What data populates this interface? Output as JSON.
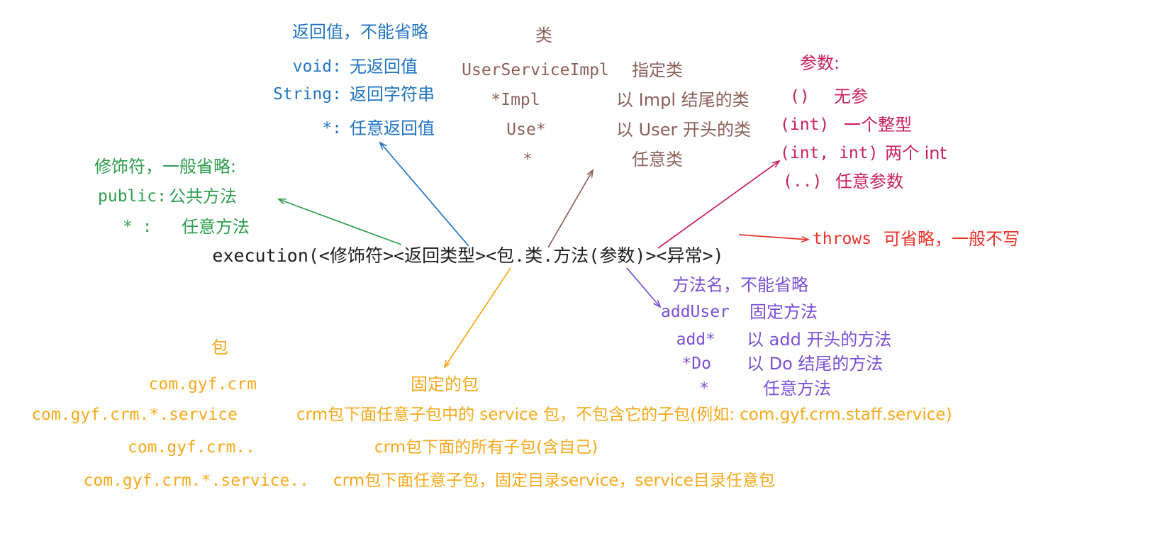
{
  "colors": {
    "modifier_green": "#2f9e4f",
    "return_blue": "#2275c2",
    "class_brown": "#8c6059",
    "params_crimson": "#c8215c",
    "method_purple": "#7a4fd6",
    "throws_red": "#e8332a",
    "package_orange": "#f7a81b",
    "formula_black": "#1d1d1f",
    "background": "#ffffff"
  },
  "formula": {
    "text": "execution(<修饰符><返回类型><包.类.方法(参数)><异常>)"
  },
  "modifier": {
    "title": "修饰符，一般省略:",
    "rows": [
      {
        "pattern": "public:",
        "desc": "公共方法"
      },
      {
        "pattern": "* :",
        "desc": "任意方法"
      }
    ]
  },
  "return_type": {
    "title": "返回值，不能省略",
    "rows": [
      {
        "pattern": "void:",
        "desc": "无返回值"
      },
      {
        "pattern": "String:",
        "desc": "返回字符串"
      },
      {
        "pattern": "*:",
        "desc": "任意返回值"
      }
    ]
  },
  "class_part": {
    "title": "类",
    "rows": [
      {
        "pattern": "UserServiceImpl",
        "desc": "指定类"
      },
      {
        "pattern": "*Impl",
        "desc": "以 Impl 结尾的类"
      },
      {
        "pattern": "Use*",
        "desc": "以 User 开头的类"
      },
      {
        "pattern": "*",
        "desc": "任意类"
      }
    ]
  },
  "params": {
    "title": "参数:",
    "rows": [
      {
        "pattern": "()",
        "desc": "无参"
      },
      {
        "pattern": "(int)",
        "desc": "一个整型"
      },
      {
        "pattern": "(int, int)",
        "desc": "两个 int"
      },
      {
        "pattern": "(..)",
        "desc": "任意参数"
      }
    ]
  },
  "method": {
    "title": "方法名，不能省略",
    "rows": [
      {
        "pattern": "addUser",
        "desc": "固定方法"
      },
      {
        "pattern": "add*",
        "desc": "以 add 开头的方法"
      },
      {
        "pattern": "*Do",
        "desc": "以 Do 结尾的方法"
      },
      {
        "pattern": "*",
        "desc": "任意方法"
      }
    ]
  },
  "throws_note": {
    "keyword": "throws",
    "desc": "可省略，一般不写"
  },
  "package_part": {
    "title": "包",
    "fixed_label": "固定的包",
    "rows": [
      {
        "pattern": "com.gyf.crm",
        "desc": ""
      },
      {
        "pattern": "com.gyf.crm.*.service",
        "desc": "crm包下面任意子包中的 service 包，不包含它的子包(例如: com.gyf.crm.staff.service)"
      },
      {
        "pattern": "com.gyf.crm..",
        "desc": "crm包下面的所有子包(含自己)"
      },
      {
        "pattern": "com.gyf.crm.*.service..",
        "desc": "crm包下面任意子包，固定目录service，service目录任意包"
      }
    ]
  }
}
